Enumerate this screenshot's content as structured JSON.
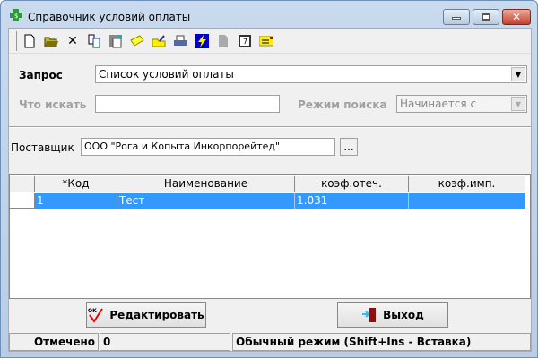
{
  "window": {
    "title": "Справочник условий оплаты",
    "icon": "green-cross-icon"
  },
  "toolbar": {
    "icons": [
      "new-document-icon",
      "open-folder-icon",
      "delete-icon",
      "copy-icon",
      "paste-icon",
      "folder-yellow-icon",
      "folder-edit-icon",
      "print-icon",
      "lightning-icon",
      "save-disabled-icon",
      "calculator-icon",
      "note-icon"
    ]
  },
  "query": {
    "label": "Запрос",
    "value": "Список условий оплаты"
  },
  "search": {
    "label": "Что искать",
    "value": "",
    "mode_label": "Режим поиска",
    "mode_value": "Начинается с"
  },
  "supplier": {
    "label": "Поставщик",
    "value": "ООО \"Рога и Копыта Инкорпорейтед\"",
    "browse": "..."
  },
  "grid": {
    "columns": [
      "*Код",
      "Наименование",
      "коэф.отеч.",
      "коэф.имп."
    ],
    "rows": [
      {
        "code": "1",
        "name": "Тест",
        "coef_dom": "1.031",
        "coef_imp": ""
      }
    ],
    "selection_color": "#3399ff"
  },
  "buttons": {
    "edit": "Редактировать",
    "exit": "Выход"
  },
  "status": {
    "marked_label": "Отмечено",
    "marked_value": "0",
    "mode": "Обычный режим (Shift+Ins - Вставка)"
  }
}
